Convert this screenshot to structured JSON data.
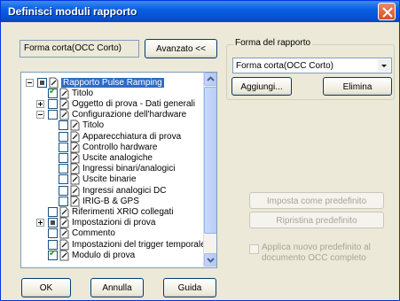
{
  "window": {
    "title": "Definisci moduli rapporto"
  },
  "left": {
    "format_value": "Forma corta(OCC Corto)",
    "advanced_button": "Avanzato <<"
  },
  "tree": {
    "items": [
      {
        "label": "Rapporto Pulse Ramping",
        "state": "partial",
        "expander": "minus",
        "selected": true
      },
      {
        "label": "Titolo",
        "state": "checked",
        "expander": ""
      },
      {
        "label": "Oggetto di prova - Dati generali",
        "state": "unchecked",
        "expander": "plus"
      },
      {
        "label": "Configurazione dell'hardware",
        "state": "unchecked",
        "expander": "minus"
      },
      {
        "label": "Titolo",
        "state": "unchecked",
        "expander": ""
      },
      {
        "label": "Apparecchiatura di prova",
        "state": "unchecked",
        "expander": ""
      },
      {
        "label": "Controllo hardware",
        "state": "unchecked",
        "expander": ""
      },
      {
        "label": "Uscite analogiche",
        "state": "unchecked",
        "expander": ""
      },
      {
        "label": "Ingressi binari/analogici",
        "state": "unchecked",
        "expander": ""
      },
      {
        "label": "Uscite binarie",
        "state": "unchecked",
        "expander": ""
      },
      {
        "label": "Ingressi analogici DC",
        "state": "unchecked",
        "expander": ""
      },
      {
        "label": "IRIG-B & GPS",
        "state": "unchecked",
        "expander": ""
      },
      {
        "label": "Riferimenti XRIO collegati",
        "state": "unchecked",
        "expander": ""
      },
      {
        "label": "Impostazioni di prova",
        "state": "partial",
        "expander": "plus"
      },
      {
        "label": "Commento",
        "state": "unchecked",
        "expander": ""
      },
      {
        "label": "Impostazioni del trigger temporale",
        "state": "unchecked",
        "expander": ""
      },
      {
        "label": "Modulo di prova",
        "state": "checked",
        "expander": ""
      }
    ]
  },
  "right": {
    "group_title": "Forma del rapporto",
    "combo_value": "Forma corta(OCC Corto)",
    "add_button": "Aggiungi...",
    "delete_button": "Elimina",
    "set_default_button": "Imposta come predefinito",
    "restore_default_button": "Ripristina predefinito",
    "apply_checkbox_label": "Applica nuovo predefinito al documento OCC completo"
  },
  "footer": {
    "ok_button": "OK",
    "cancel_button": "Annulla",
    "help_button": "Guida"
  },
  "colors": {
    "titlebar": "#0553d8",
    "selection": "#316ac5",
    "close": "#d4502a",
    "face": "#ece9d8"
  }
}
